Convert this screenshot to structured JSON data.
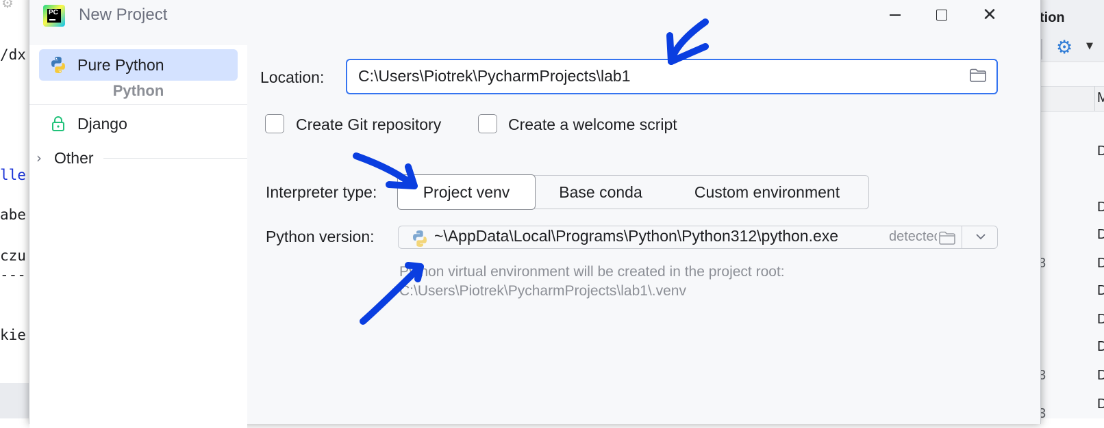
{
  "background_ide": {
    "left_code_lines": [
      "/dx",
      "lle",
      "abe",
      "czu",
      "---",
      "kie"
    ],
    "right_header_label": "tion",
    "right_column_header": "M",
    "right_cells": [
      "D",
      "D",
      "D",
      "D",
      "D",
      "D",
      "D",
      "D",
      "D",
      "D"
    ],
    "right_numbers": [
      "3",
      "3",
      "3"
    ]
  },
  "dialog": {
    "title": "New Project",
    "app_icon_text": "PC"
  },
  "nav": {
    "items": [
      {
        "label": "Pure Python",
        "icon": "python-icon",
        "selected": true
      },
      {
        "label": "Django",
        "icon": "lock-icon",
        "selected": false
      }
    ],
    "group_label": "Python",
    "other_label": "Other"
  },
  "form": {
    "location_label": "Location:",
    "location_value": "C:\\Users\\Piotrek\\PycharmProjects\\lab1",
    "create_git_label": "Create Git repository",
    "create_welcome_label": "Create a welcome script",
    "interpreter_type_label": "Interpreter type:",
    "interpreter_options": [
      "Project venv",
      "Base conda",
      "Custom environment"
    ],
    "interpreter_selected": "Project venv",
    "python_version_label": "Python version:",
    "python_version_value": "~\\AppData\\Local\\Programs\\Python\\Python312\\python.exe",
    "python_version_detected": "detected",
    "hint_line1": "Python virtual environment will be created in the project root:",
    "hint_line2": "C:\\Users\\Piotrek\\PycharmProjects\\lab1\\.venv"
  },
  "colors": {
    "accent": "#3574f0",
    "selection": "#d4e2ff",
    "annotation": "#0a3ee0"
  }
}
